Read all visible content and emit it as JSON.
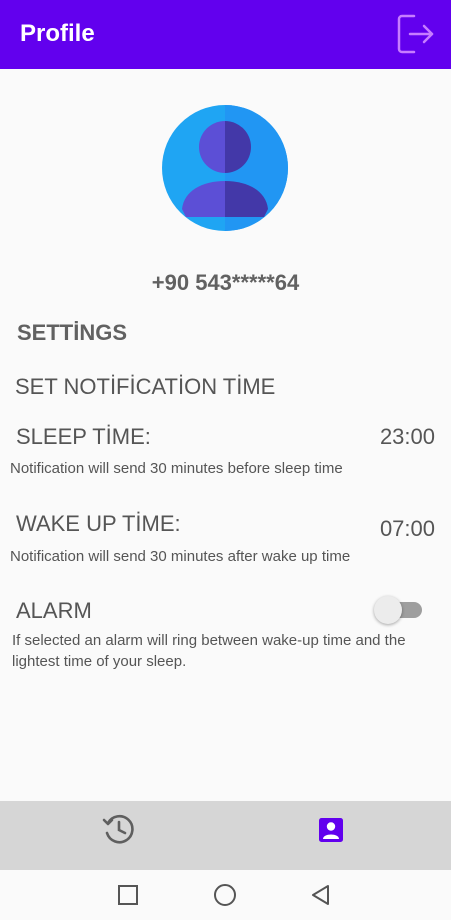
{
  "app_bar": {
    "title": "Profile",
    "logout_icon": "logout-icon"
  },
  "profile": {
    "avatar_icon": "user-avatar-icon",
    "phone": "+90 543*****64"
  },
  "settings": {
    "heading": "SETTİNGS",
    "notification_heading": "SET NOTİFİCATİON TİME",
    "sleep": {
      "label": "SLEEP TİME:",
      "time": "23:00",
      "note": "Notification will send 30 minutes before sleep time"
    },
    "wake": {
      "label": "WAKE UP TİME:",
      "time": "07:00",
      "note": "Notification will send 30 minutes after wake up time"
    },
    "alarm": {
      "label": "ALARM",
      "enabled": false,
      "note": "If selected an alarm will ring between wake-up time and the lightest time of your sleep."
    }
  },
  "bottom_nav": {
    "items": [
      {
        "icon": "history-icon",
        "selected": false
      },
      {
        "icon": "profile-icon",
        "selected": true
      }
    ]
  },
  "system_nav": {
    "buttons": [
      "recents-square-icon",
      "home-circle-icon",
      "back-triangle-icon"
    ]
  },
  "colors": {
    "primary": "#6200ee",
    "accent_logout": "#c77dff",
    "nav_bg": "#d6d6d6"
  }
}
